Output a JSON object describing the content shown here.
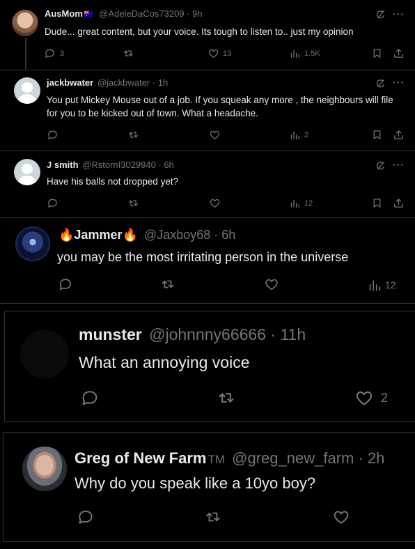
{
  "tweets": [
    {
      "name": "AusMom",
      "flag": "🇦🇺",
      "handle": "@AdeleDaCos73209",
      "time": "· 9h",
      "text": "Dude... great content, but your voice. Its tough to listen to.. just my opinion",
      "replies": "3",
      "likes": "13",
      "views": "1.5K"
    },
    {
      "name": "jackbwater",
      "handle": "@jackbwater",
      "time": "· 1h",
      "text": "You put Mickey Mouse out of a job. If you squeak any more , the neighbours will file for you to be kicked out of town. What a headache.",
      "views": "2"
    },
    {
      "name": "J smith",
      "handle": "@RstornI3029940",
      "time": "· 6h",
      "text": "Have his balls not dropped yet?",
      "views": "12"
    },
    {
      "name": "Jammer",
      "emoji": "🔥",
      "handle": "@Jaxboy68",
      "time": "· 6h",
      "text": "you may be the most irritating person in the universe",
      "views": "12"
    },
    {
      "name": "munster",
      "handle": "@johnnny66666",
      "time": "· 11h",
      "text": "What an annoying voice",
      "likes": "2"
    },
    {
      "name": "Greg of New Farm",
      "tm": "TM",
      "handle": "@greg_new_farm",
      "time": "· 2h",
      "text": "Why do you speak like a 10yo boy?"
    }
  ],
  "icons": {
    "reply": "reply-icon",
    "retweet": "retweet-icon",
    "like": "like-icon",
    "views": "views-icon",
    "bookmark": "bookmark-icon",
    "share": "share-icon",
    "grok": "grok-icon",
    "more": "more-icon"
  }
}
